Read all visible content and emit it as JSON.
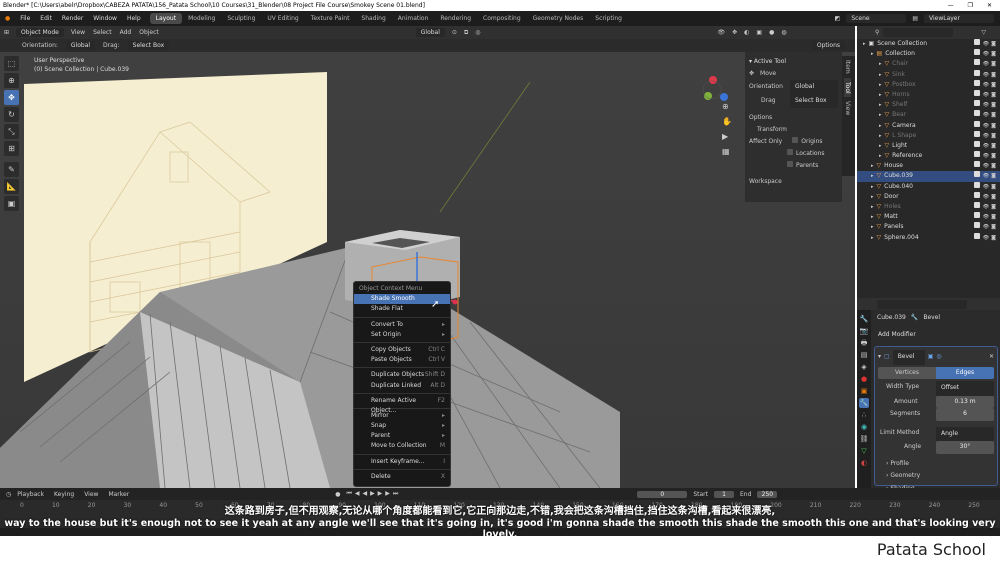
{
  "window": {
    "title": "Blender* [C:\\Users\\abelr\\Dropbox\\CABEZA PATATA\\156_Patata School\\10 Courses\\31_Blender\\08 Project File Course\\Smokey Scene 01.blend]",
    "controls": [
      "—",
      "❐",
      "✕"
    ]
  },
  "menubar": [
    "File",
    "Edit",
    "Render",
    "Window",
    "Help"
  ],
  "workspaces": [
    "Layout",
    "Modeling",
    "Sculpting",
    "UV Editing",
    "Texture Paint",
    "Shading",
    "Animation",
    "Rendering",
    "Compositing",
    "Geometry Nodes",
    "Scripting"
  ],
  "active_workspace": "Layout",
  "scene": "Scene",
  "view_layer": "ViewLayer",
  "header": {
    "mode": "Object Mode",
    "menus": [
      "View",
      "Select",
      "Add",
      "Object"
    ],
    "transform": "Global",
    "options": "Options"
  },
  "toolheader": {
    "orientation_label": "Orientation:",
    "orientation": "Global",
    "drag_label": "Drag:",
    "drag": "Select Box"
  },
  "viewport": {
    "view": "User Perspective",
    "collection": "(0) Scene Collection | Cube.039"
  },
  "npanel": {
    "tabs": [
      "Item",
      "Tool",
      "View"
    ],
    "active_tool": "Active Tool",
    "move": "Move",
    "orientation_label": "Orientation",
    "orientation": "Global",
    "drag_label": "Drag",
    "drag": "Select Box",
    "options": "Options",
    "transform": "Transform",
    "affect_only": "Affect Only",
    "origins": "Origins",
    "locations": "Locations",
    "parents": "Parents",
    "workspace": "Workspace"
  },
  "context_menu": {
    "title": "Object Context Menu",
    "items": [
      {
        "label": "Shade Smooth",
        "sc": "",
        "hl": true
      },
      {
        "label": "Shade Flat",
        "sc": ""
      },
      {
        "sep": true
      },
      {
        "label": "Convert To",
        "sc": "▸"
      },
      {
        "label": "Set Origin",
        "sc": "▸"
      },
      {
        "sep": true
      },
      {
        "label": "Copy Objects",
        "sc": "Ctrl C"
      },
      {
        "label": "Paste Objects",
        "sc": "Ctrl V"
      },
      {
        "sep": true
      },
      {
        "label": "Duplicate Objects",
        "sc": "Shift D"
      },
      {
        "label": "Duplicate Linked",
        "sc": "Alt D"
      },
      {
        "sep": true
      },
      {
        "label": "Rename Active Object...",
        "sc": "F2"
      },
      {
        "sep": true
      },
      {
        "label": "Mirror",
        "sc": "▸"
      },
      {
        "label": "Snap",
        "sc": "▸"
      },
      {
        "label": "Parent",
        "sc": "▸"
      },
      {
        "label": "Move to Collection",
        "sc": "M"
      },
      {
        "sep": true
      },
      {
        "label": "Insert Keyframe...",
        "sc": "I"
      },
      {
        "sep": true
      },
      {
        "label": "Delete",
        "sc": "X"
      }
    ]
  },
  "outliner": {
    "rows": [
      {
        "label": "Scene Collection",
        "indent": 0,
        "sel": false,
        "dim": false
      },
      {
        "label": "Collection",
        "indent": 1,
        "sel": false,
        "dim": false
      },
      {
        "label": "Chair",
        "indent": 2,
        "sel": false,
        "dim": true
      },
      {
        "label": "Sink",
        "indent": 2,
        "sel": false,
        "dim": true
      },
      {
        "label": "Postbox",
        "indent": 2,
        "sel": false,
        "dim": true
      },
      {
        "label": "Horns",
        "indent": 2,
        "sel": false,
        "dim": true
      },
      {
        "label": "Shelf",
        "indent": 2,
        "sel": false,
        "dim": true
      },
      {
        "label": "Bear",
        "indent": 2,
        "sel": false,
        "dim": true
      },
      {
        "label": "Camera",
        "indent": 2,
        "sel": false,
        "dim": false
      },
      {
        "label": "L Shape",
        "indent": 2,
        "sel": false,
        "dim": true
      },
      {
        "label": "Light",
        "indent": 2,
        "sel": false,
        "dim": false
      },
      {
        "label": "Reference",
        "indent": 2,
        "sel": false,
        "dim": false
      },
      {
        "label": "House",
        "indent": 1,
        "sel": false,
        "dim": false
      },
      {
        "label": "Cube.039",
        "indent": 1,
        "sel": true,
        "dim": false
      },
      {
        "label": "Cube.040",
        "indent": 1,
        "sel": false,
        "dim": false
      },
      {
        "label": "Door",
        "indent": 1,
        "sel": false,
        "dim": false
      },
      {
        "label": "Holes",
        "indent": 1,
        "sel": false,
        "dim": true
      },
      {
        "label": "Matt",
        "indent": 1,
        "sel": false,
        "dim": false
      },
      {
        "label": "Panels",
        "indent": 1,
        "sel": false,
        "dim": false
      },
      {
        "label": "Sphere.004",
        "indent": 1,
        "sel": false,
        "dim": false
      }
    ]
  },
  "properties": {
    "object": "Cube.039",
    "modifier_name": "Bevel",
    "add_modifier": "Add Modifier",
    "mod_field": "Bevel",
    "vertices": "Vertices",
    "edges": "Edges",
    "width_type_label": "Width Type",
    "width_type": "Offset",
    "amount_label": "Amount",
    "amount": "0.13 m",
    "segments_label": "Segments",
    "segments": "6",
    "limit_label": "Limit Method",
    "limit": "Angle",
    "angle_label": "Angle",
    "angle": "30°",
    "profile": "Profile",
    "geometry": "Geometry",
    "shading": "Shading"
  },
  "timeline": {
    "menus": [
      "Playback",
      "Keying",
      "View",
      "Marker"
    ],
    "frame": "0",
    "start_label": "Start",
    "start": "1",
    "end_label": "End",
    "end": "250",
    "ticks": [
      "0",
      "10",
      "20",
      "30",
      "40",
      "50",
      "60",
      "70",
      "80",
      "90",
      "100",
      "110",
      "120",
      "130",
      "140",
      "150",
      "160",
      "170",
      "180",
      "190",
      "200",
      "210",
      "220",
      "230",
      "240",
      "250"
    ]
  },
  "subtitles": {
    "cn": "这条路到房子,但不用观察,无论从哪个角度都能看到它,它正向那边走,不错,我会把这条沟槽挡住,挡住这条沟槽,看起来很漂亮,",
    "en": "way to the house but it's enough not to see it yeah at any angle we'll see that it's going in, it's good i'm gonna shade the smooth this shade the smooth this one and that's looking very lovely,"
  },
  "brand": "Patata School"
}
